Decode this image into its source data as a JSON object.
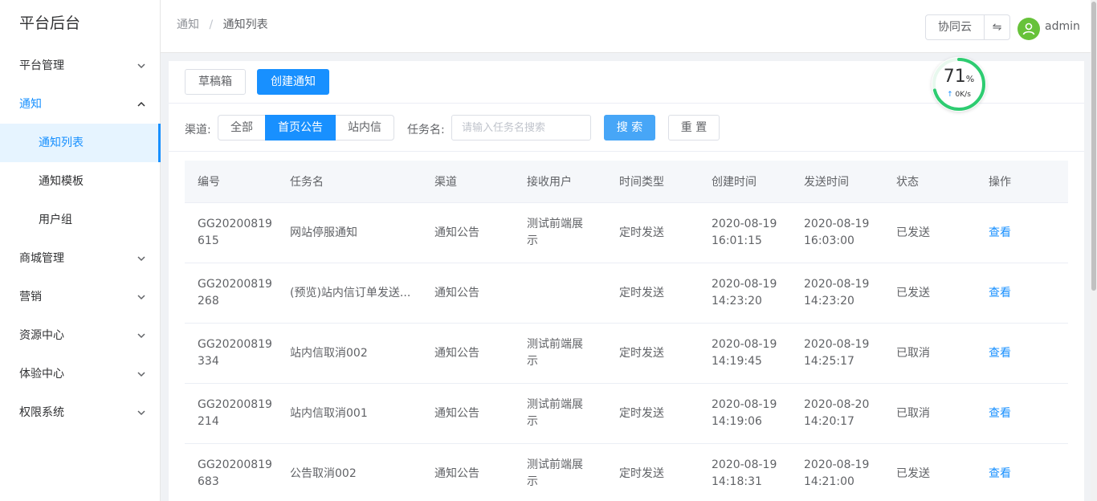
{
  "app": {
    "title": "平台后台"
  },
  "sidebar": {
    "items": [
      {
        "label": "平台管理"
      },
      {
        "label": "通知",
        "children": [
          {
            "label": "通知列表"
          },
          {
            "label": "通知模板"
          },
          {
            "label": "用户组"
          }
        ]
      },
      {
        "label": "商城管理"
      },
      {
        "label": "营销"
      },
      {
        "label": "资源中心"
      },
      {
        "label": "体验中心"
      },
      {
        "label": "权限系统"
      }
    ],
    "active_item": "通知列表"
  },
  "header": {
    "breadcrumb": [
      "通知",
      "通知列表"
    ],
    "breadcrumb_sep": "/",
    "workspace_button": "协同云",
    "switch_icon": "⇋",
    "username": "admin"
  },
  "toolbar": {
    "drafts_label": "草稿箱",
    "create_label": "创建通知"
  },
  "filters": {
    "channel_label": "渠道:",
    "channels": [
      "全部",
      "首页公告",
      "站内信"
    ],
    "selected_channel": "首页公告",
    "task_label": "任务名:",
    "task_placeholder": "请输入任务名搜索",
    "search_label": "搜 索",
    "reset_label": "重 置"
  },
  "table": {
    "columns": [
      "编号",
      "任务名",
      "渠道",
      "接收用户",
      "时间类型",
      "创建时间",
      "发送时间",
      "状态",
      "操作"
    ],
    "rows": [
      {
        "id1": "GG20200819",
        "id2": "615",
        "name": "网站停服通知",
        "channel": "通知公告",
        "recv1": "测试前端展",
        "recv2": "示",
        "time_type": "定时发送",
        "created1": "2020-08-19",
        "created2": "16:01:15",
        "sent1": "2020-08-19",
        "sent2": "16:03:00",
        "status": "已发送",
        "action": "查看"
      },
      {
        "id1": "GG20200819",
        "id2": "268",
        "name": "(预览)站内信订单发送...",
        "channel": "通知公告",
        "recv1": "",
        "recv2": "",
        "time_type": "定时发送",
        "created1": "2020-08-19",
        "created2": "14:23:20",
        "sent1": "2020-08-19",
        "sent2": "14:23:20",
        "status": "已发送",
        "action": "查看"
      },
      {
        "id1": "GG20200819",
        "id2": "334",
        "name": "站内信取消002",
        "channel": "通知公告",
        "recv1": "测试前端展",
        "recv2": "示",
        "time_type": "定时发送",
        "created1": "2020-08-19",
        "created2": "14:19:45",
        "sent1": "2020-08-19",
        "sent2": "14:25:17",
        "status": "已取消",
        "action": "查看"
      },
      {
        "id1": "GG20200819",
        "id2": "214",
        "name": "站内信取消001",
        "channel": "通知公告",
        "recv1": "测试前端展",
        "recv2": "示",
        "time_type": "定时发送",
        "created1": "2020-08-19",
        "created2": "14:19:06",
        "sent1": "2020-08-20",
        "sent2": "14:20:17",
        "status": "已取消",
        "action": "查看"
      },
      {
        "id1": "GG20200819",
        "id2": "683",
        "name": "公告取消002",
        "channel": "通知公告",
        "recv1": "测试前端展",
        "recv2": "示",
        "time_type": "定时发送",
        "created1": "2020-08-19",
        "created2": "14:18:31",
        "sent1": "2020-08-19",
        "sent2": "14:21:00",
        "status": "已发送",
        "action": "查看"
      }
    ]
  },
  "gauge": {
    "percent_number": "71",
    "percent_sign": "%",
    "progress": 0.71,
    "speed": "0K/s",
    "color": "#2ecc71"
  },
  "colors": {
    "primary": "#1890ff",
    "accent_light": "#e6f4ff"
  }
}
